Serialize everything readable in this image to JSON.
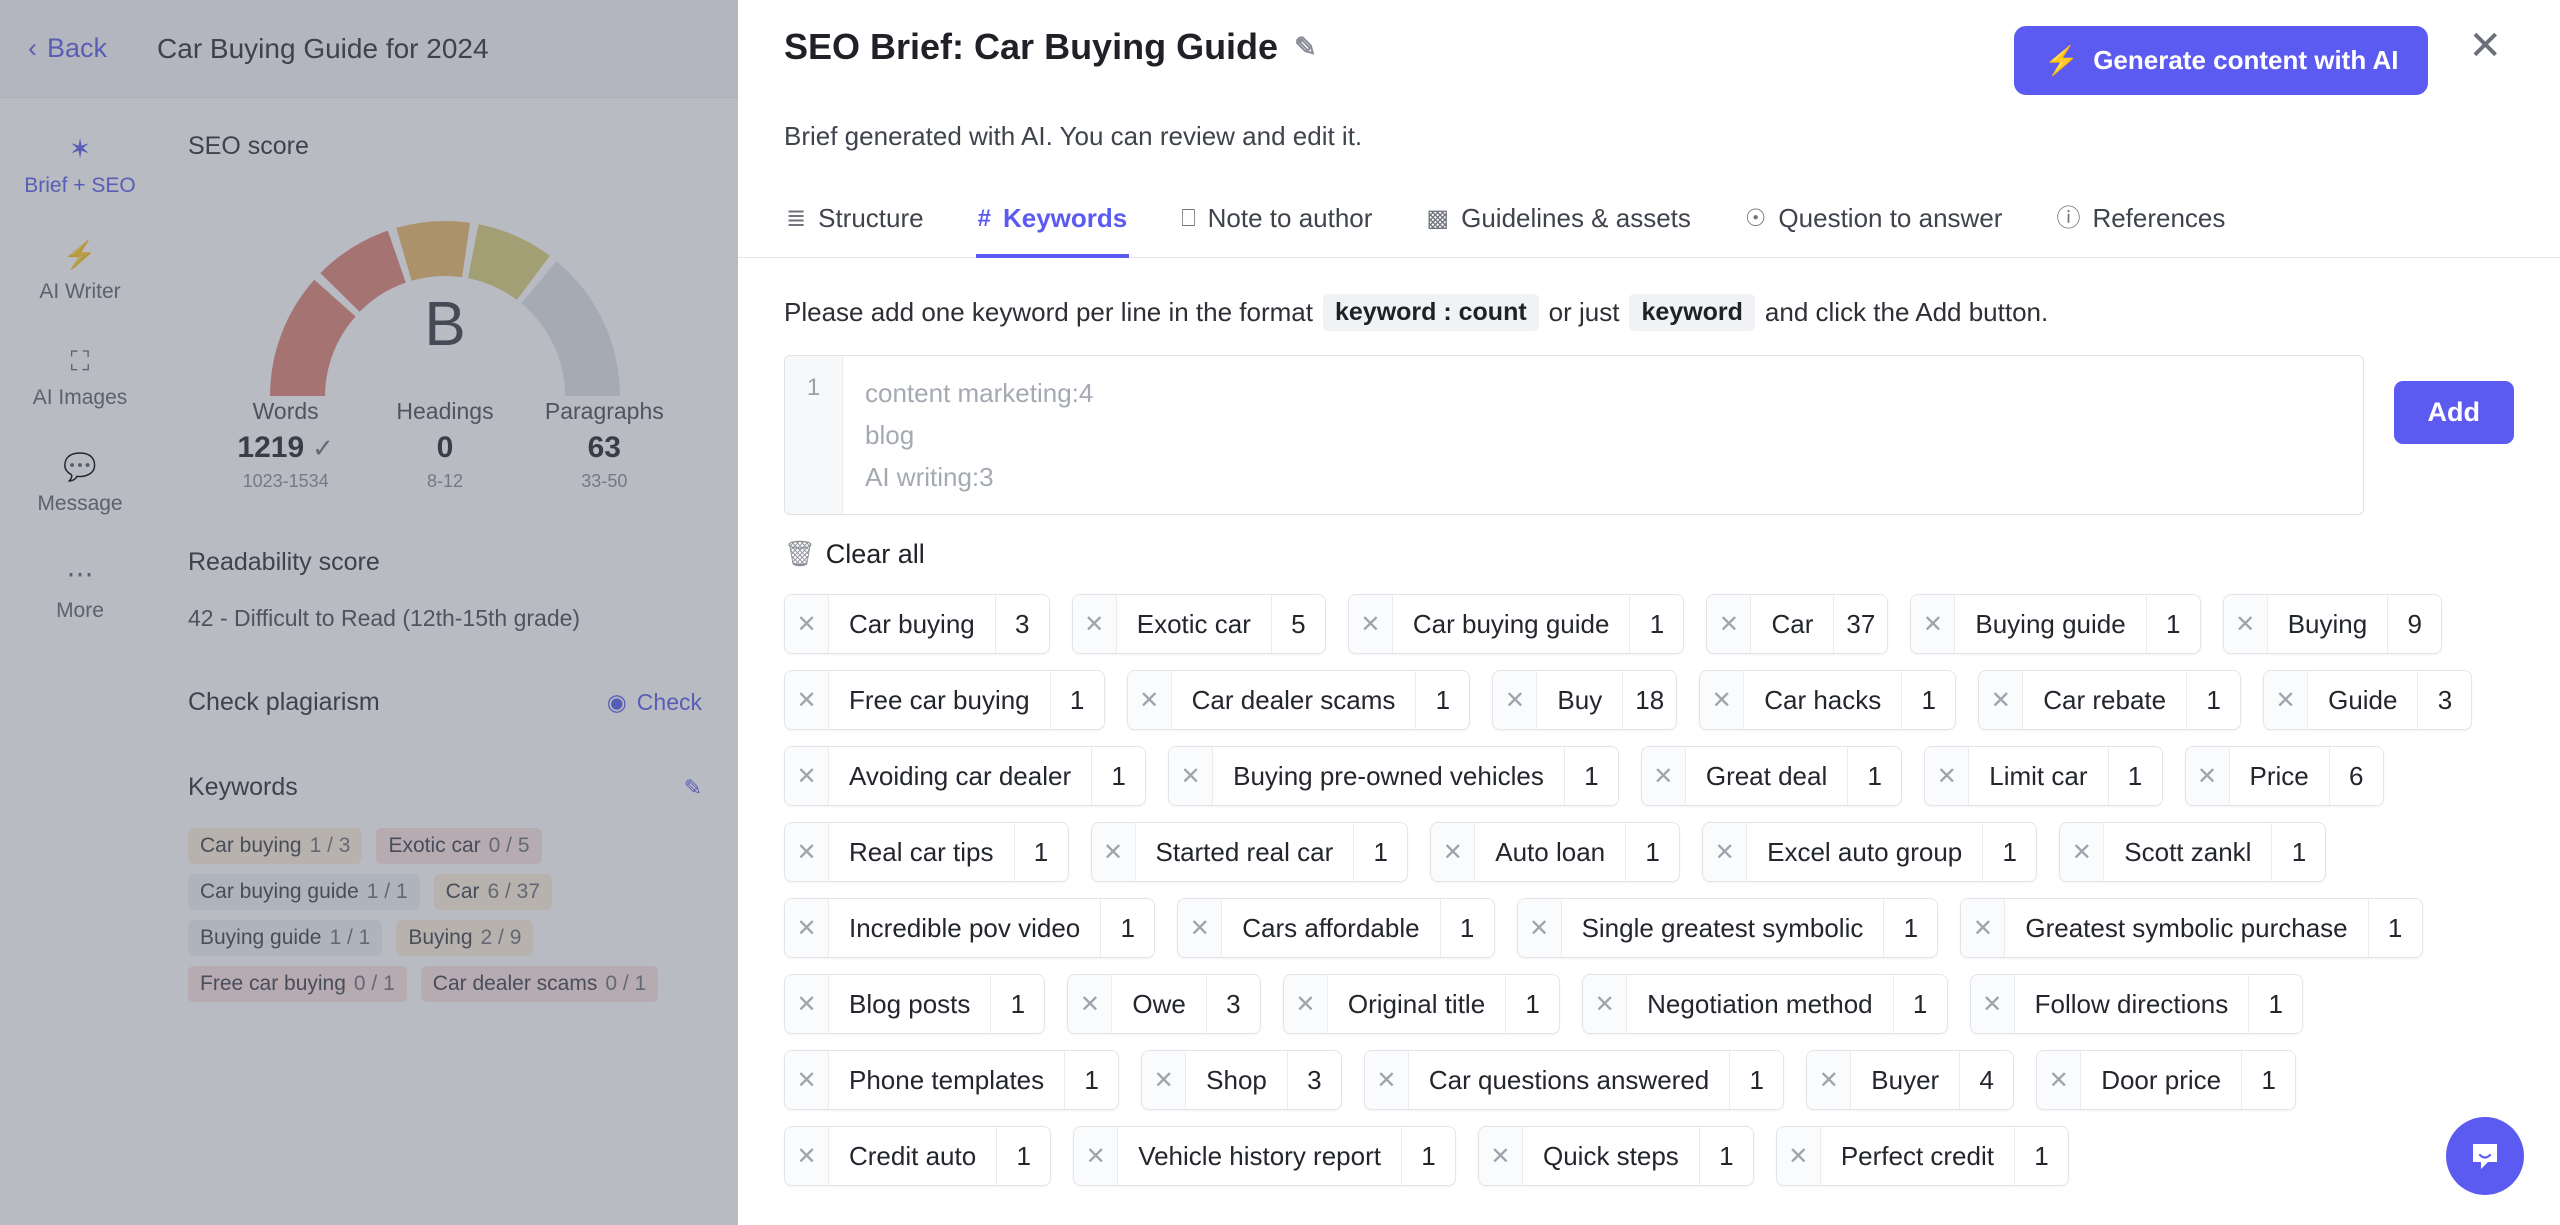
{
  "left": {
    "topbar": {
      "back_label": "Back",
      "doc_title": "Car Buying Guide for 2024"
    },
    "rail": [
      {
        "label": "Brief + SEO",
        "icon": "target-icon",
        "glyph": "✲"
      },
      {
        "label": "AI Writer",
        "icon": "bolt-icon",
        "glyph": "⚡"
      },
      {
        "label": "AI Images",
        "icon": "image-icon",
        "glyph": "Ὓc"
      },
      {
        "label": "Message",
        "icon": "message-icon",
        "glyph": "■"
      },
      {
        "label": "More",
        "icon": "more-icon",
        "glyph": "⋯"
      }
    ],
    "seo": {
      "title": "SEO score",
      "grade": "B",
      "stats": [
        {
          "label": "Words",
          "value": "1219",
          "tick": "✓",
          "range": "1023-1534"
        },
        {
          "label": "Headings",
          "value": "0",
          "tick": "",
          "range": "8-12"
        },
        {
          "label": "Paragraphs",
          "value": "63",
          "tick": "",
          "range": "33-50"
        }
      ]
    },
    "readability": {
      "title": "Readability score",
      "text": "42 - Difficult to Read (12th-15th grade)"
    },
    "plagiarism": {
      "title": "Check plagiarism",
      "action": "Check"
    },
    "keywords_section": {
      "title": "Keywords",
      "items": [
        {
          "text": "Car buying",
          "count": "1 / 3",
          "state": "warn"
        },
        {
          "text": "Exotic car",
          "count": "0 / 5",
          "state": "bad"
        },
        {
          "text": "Car buying guide",
          "count": "1 / 1",
          "state": "ok"
        },
        {
          "text": "Car",
          "count": "6 / 37",
          "state": "warn"
        },
        {
          "text": "Buying guide",
          "count": "1 / 1",
          "state": "ok"
        },
        {
          "text": "Buying",
          "count": "2 / 9",
          "state": "warn"
        },
        {
          "text": "Free car buying",
          "count": "0 / 1",
          "state": "bad"
        },
        {
          "text": "Car dealer scams",
          "count": "0 / 1",
          "state": "bad"
        }
      ]
    }
  },
  "panel": {
    "title": "SEO Brief: Car Buying Guide",
    "subtitle": "Brief generated with AI. You can review and edit it.",
    "generate_label": "Generate content with AI",
    "tabs": [
      {
        "label": "Structure",
        "icon": "list-icon",
        "glyph": "≣",
        "active": false
      },
      {
        "label": "Keywords",
        "icon": "hash-icon",
        "glyph": "#",
        "active": true
      },
      {
        "label": "Note to author",
        "icon": "note-icon",
        "glyph": "□",
        "active": false
      },
      {
        "label": "Guidelines & assets",
        "icon": "bars-icon",
        "glyph": "▐",
        "active": false
      },
      {
        "label": "Question to answer",
        "icon": "question-circle-icon",
        "glyph": "?",
        "active": false
      },
      {
        "label": "References",
        "icon": "info-circle-icon",
        "glyph": "i",
        "active": false
      }
    ],
    "hint": {
      "before": "Please add one keyword per line in the format",
      "code1": "keyword : count",
      "middle": "or just",
      "code2": "keyword",
      "after": "and click the Add button."
    },
    "textarea": {
      "line_number": "1",
      "placeholder": "content marketing:4\nblog\nAI writing:3",
      "value": ""
    },
    "add_label": "Add",
    "clear_all_label": "Clear all",
    "chips": [
      {
        "label": "Car buying",
        "count": "3"
      },
      {
        "label": "Exotic car",
        "count": "5"
      },
      {
        "label": "Car buying guide",
        "count": "1"
      },
      {
        "label": "Car",
        "count": "37"
      },
      {
        "label": "Buying guide",
        "count": "1"
      },
      {
        "label": "Buying",
        "count": "9"
      },
      {
        "label": "Free car buying",
        "count": "1"
      },
      {
        "label": "Car dealer scams",
        "count": "1"
      },
      {
        "label": "Buy",
        "count": "18"
      },
      {
        "label": "Car hacks",
        "count": "1"
      },
      {
        "label": "Car rebate",
        "count": "1"
      },
      {
        "label": "Guide",
        "count": "3"
      },
      {
        "label": "Avoiding car dealer",
        "count": "1"
      },
      {
        "label": "Buying pre-owned vehicles",
        "count": "1"
      },
      {
        "label": "Great deal",
        "count": "1"
      },
      {
        "label": "Limit car",
        "count": "1"
      },
      {
        "label": "Price",
        "count": "6"
      },
      {
        "label": "Real car tips",
        "count": "1"
      },
      {
        "label": "Started real car",
        "count": "1"
      },
      {
        "label": "Auto loan",
        "count": "1"
      },
      {
        "label": "Excel auto group",
        "count": "1"
      },
      {
        "label": "Scott zankl",
        "count": "1"
      },
      {
        "label": "Incredible pov video",
        "count": "1"
      },
      {
        "label": "Cars affordable",
        "count": "1"
      },
      {
        "label": "Single greatest symbolic",
        "count": "1"
      },
      {
        "label": "Greatest symbolic purchase",
        "count": "1"
      },
      {
        "label": "Blog posts",
        "count": "1"
      },
      {
        "label": "Owe",
        "count": "3"
      },
      {
        "label": "Original title",
        "count": "1"
      },
      {
        "label": "Negotiation method",
        "count": "1"
      },
      {
        "label": "Follow directions",
        "count": "1"
      },
      {
        "label": "Phone templates",
        "count": "1"
      },
      {
        "label": "Shop",
        "count": "3"
      },
      {
        "label": "Car questions answered",
        "count": "1"
      },
      {
        "label": "Buyer",
        "count": "4"
      },
      {
        "label": "Door price",
        "count": "1"
      },
      {
        "label": "Credit auto",
        "count": "1"
      },
      {
        "label": "Vehicle history report",
        "count": "1"
      },
      {
        "label": "Quick steps",
        "count": "1"
      },
      {
        "label": "Perfect credit",
        "count": "1"
      }
    ],
    "close_label": "✕"
  },
  "colors": {
    "accent": "#5b5bf2",
    "link": "#5b5fe8",
    "gauge_red": "#e08377",
    "gauge_orange": "#e8b86a",
    "gauge_yellow": "#d9cf7a"
  }
}
